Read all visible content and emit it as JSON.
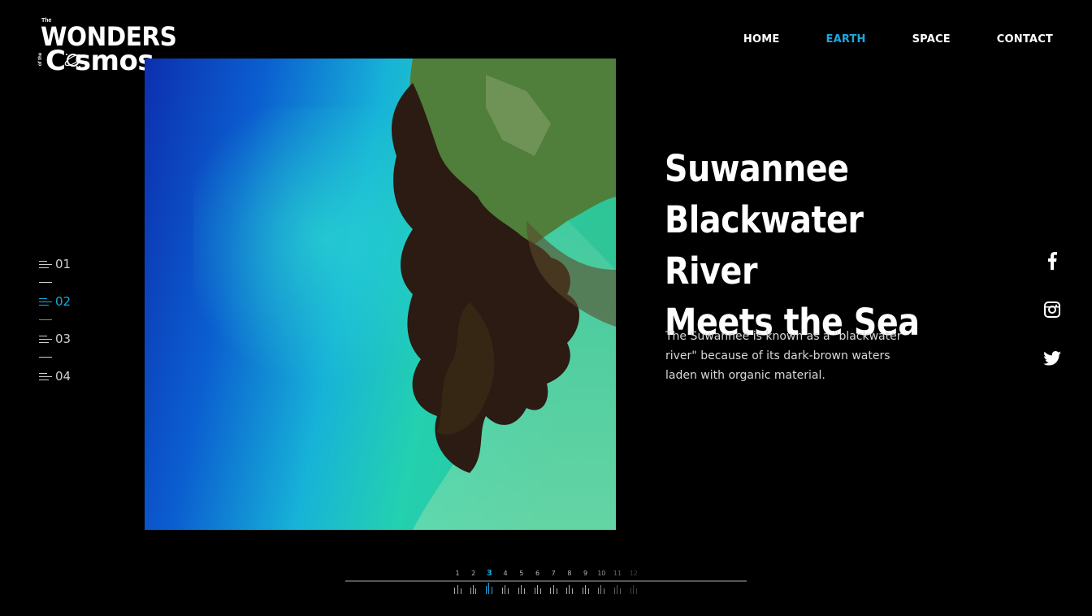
{
  "logo": {
    "the": "The",
    "of_the": "of the",
    "line1": "WONDERS",
    "line2": "C smos"
  },
  "nav": {
    "items": [
      "HOME",
      "EARTH",
      "SPACE",
      "CONTACT"
    ],
    "active_index": 1
  },
  "slides": {
    "items": [
      "01",
      "02",
      "03",
      "04"
    ],
    "active_index": 1
  },
  "article": {
    "title_line1": "Suwannee",
    "title_line2": "Blackwater River",
    "title_line3": "Meets the Sea",
    "description": "The Suwannee is known as a \"blackwater river\" because of its dark-brown waters laden with organic material."
  },
  "social": [
    "facebook-icon",
    "instagram-icon",
    "twitter-icon"
  ],
  "timeline": {
    "ticks": [
      "1",
      "2",
      "3",
      "4",
      "5",
      "6",
      "7",
      "8",
      "9",
      "10",
      "11",
      "12"
    ],
    "active_index": 2
  },
  "colors": {
    "accent": "#19a9e0",
    "background": "#000000",
    "text": "#ffffff"
  }
}
